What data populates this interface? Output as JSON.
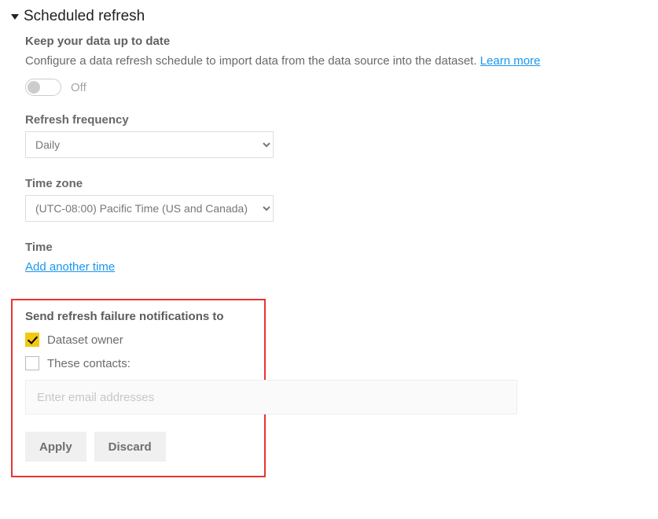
{
  "section": {
    "title": "Scheduled refresh"
  },
  "keepUpToDate": {
    "heading": "Keep your data up to date",
    "desc": "Configure a data refresh schedule to import data from the data source into the dataset. ",
    "learnMore": "Learn more"
  },
  "toggle": {
    "state": "Off"
  },
  "frequency": {
    "label": "Refresh frequency",
    "value": "Daily"
  },
  "timezone": {
    "label": "Time zone",
    "value": "(UTC-08:00) Pacific Time (US and Canada)"
  },
  "time": {
    "label": "Time",
    "addLink": "Add another time"
  },
  "notify": {
    "heading": "Send refresh failure notifications to",
    "datasetOwner": "Dataset owner",
    "theseContacts": "These contacts:",
    "emailPlaceholder": "Enter email addresses"
  },
  "buttons": {
    "apply": "Apply",
    "discard": "Discard"
  }
}
